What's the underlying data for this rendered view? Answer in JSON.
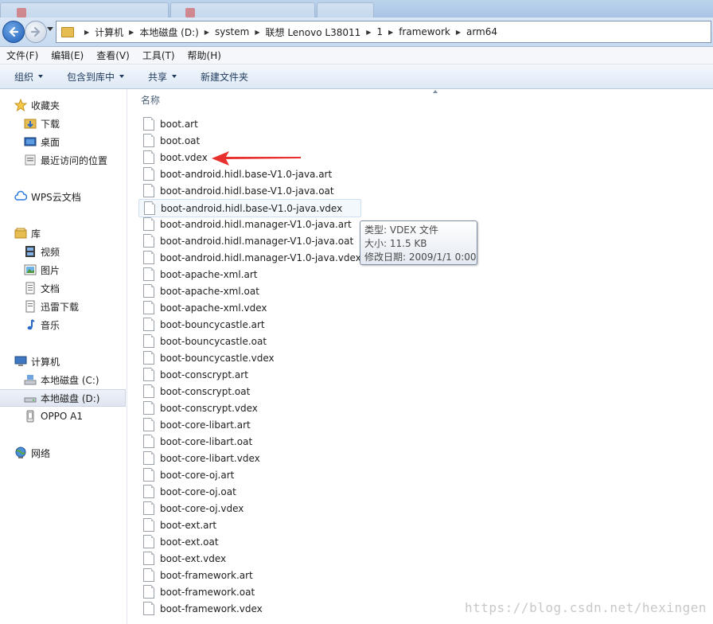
{
  "breadcrumb": [
    "计算机",
    "本地磁盘 (D:)",
    "system",
    "联想 Lenovo L38011",
    "1",
    "framework",
    "arm64"
  ],
  "menu": [
    "文件(F)",
    "编辑(E)",
    "查看(V)",
    "工具(T)",
    "帮助(H)"
  ],
  "toolbar": {
    "organize": "组织",
    "include_in_library": "包含到库中",
    "share": "共享",
    "new_folder": "新建文件夹"
  },
  "sidebar": {
    "favorites": {
      "label": "收藏夹",
      "items": [
        "下载",
        "桌面",
        "最近访问的位置"
      ]
    },
    "wps": "WPS云文档",
    "libraries": {
      "label": "库",
      "items": [
        "视频",
        "图片",
        "文档",
        "迅雷下载",
        "音乐"
      ]
    },
    "computer": {
      "label": "计算机",
      "items": [
        "本地磁盘 (C:)",
        "本地磁盘 (D:)",
        "OPPO A1"
      ]
    },
    "network": "网络"
  },
  "content": {
    "column_name": "名称",
    "files": [
      "boot.art",
      "boot.oat",
      "boot.vdex",
      "boot-android.hidl.base-V1.0-java.art",
      "boot-android.hidl.base-V1.0-java.oat",
      "boot-android.hidl.base-V1.0-java.vdex",
      "boot-android.hidl.manager-V1.0-java.art",
      "boot-android.hidl.manager-V1.0-java.oat",
      "boot-android.hidl.manager-V1.0-java.vdex",
      "boot-apache-xml.art",
      "boot-apache-xml.oat",
      "boot-apache-xml.vdex",
      "boot-bouncycastle.art",
      "boot-bouncycastle.oat",
      "boot-bouncycastle.vdex",
      "boot-conscrypt.art",
      "boot-conscrypt.oat",
      "boot-conscrypt.vdex",
      "boot-core-libart.art",
      "boot-core-libart.oat",
      "boot-core-libart.vdex",
      "boot-core-oj.art",
      "boot-core-oj.oat",
      "boot-core-oj.vdex",
      "boot-ext.art",
      "boot-ext.oat",
      "boot-ext.vdex",
      "boot-framework.art",
      "boot-framework.oat",
      "boot-framework.vdex"
    ]
  },
  "tooltip": {
    "type": "类型: VDEX 文件",
    "size": "大小: 11.5 KB",
    "modified": "修改日期: 2009/1/1 0:00"
  },
  "watermark": "https://blog.csdn.net/hexingen",
  "colors": {
    "accent": "#1f5fb8",
    "arrow": "#e8312f",
    "selected_bg": "#dfe6f1"
  }
}
